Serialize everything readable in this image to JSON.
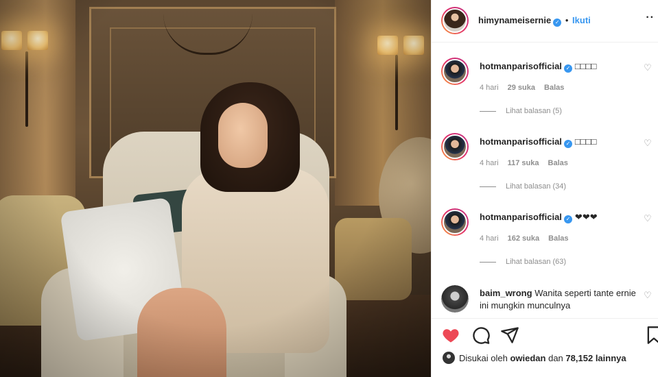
{
  "post": {
    "author": "himynameisernie",
    "separator": "•",
    "follow_label": "Ikuti",
    "more_icon": "more-horizontal-icon"
  },
  "comments": [
    {
      "username": "hotmanparisofficial",
      "text": "□□□□",
      "time": "4 hari",
      "likes": "29 suka",
      "reply_label": "Balas",
      "view_replies": "Lihat balasan (5)"
    },
    {
      "username": "hotmanparisofficial",
      "text": "□□□□",
      "time": "4 hari",
      "likes": "117 suka",
      "reply_label": "Balas",
      "view_replies": "Lihat balasan (34)"
    },
    {
      "username": "hotmanparisofficial",
      "text": "❤❤❤",
      "time": "4 hari",
      "likes": "162 suka",
      "reply_label": "Balas",
      "view_replies": "Lihat balasan (63)"
    },
    {
      "username": "baim_wrong",
      "text": "Wanita seperti tante ernie ini mungkin munculnya"
    }
  ],
  "actions": {
    "like_icon": "heart-filled-icon",
    "comment_icon": "comment-icon",
    "share_icon": "share-icon",
    "save_icon": "bookmark-icon",
    "like_color": "#ed4956"
  },
  "liked_by": {
    "prefix": "Disukai oleh",
    "user": "owiedan",
    "middle": "dan",
    "count": "78,152",
    "suffix": "lainnya"
  },
  "colors": {
    "accent": "#3897f0",
    "muted": "#8e8e8e",
    "text": "#262626"
  }
}
